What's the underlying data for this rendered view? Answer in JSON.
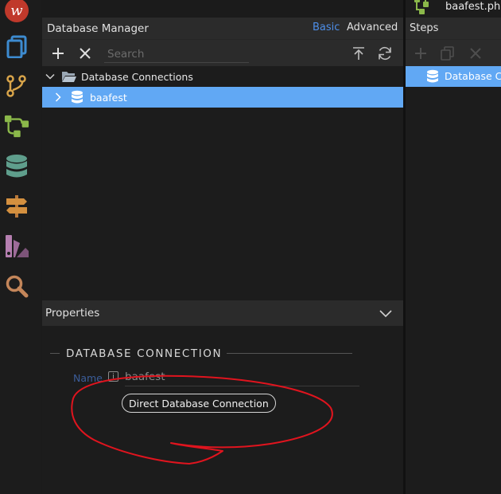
{
  "db_manager": {
    "title": "Database Manager",
    "mode_basic": "Basic",
    "mode_advanced": "Advanced",
    "search_placeholder": "Search",
    "tree": {
      "root_label": "Database Connections",
      "child_label": "baafest"
    }
  },
  "properties": {
    "title": "Properties",
    "section_title": "DATABASE CONNECTION",
    "name_label": "Name",
    "info_glyph": "i",
    "name_value": "baafest",
    "connection_type": "Direct Database Connection"
  },
  "right_panel": {
    "file_tab": "baafest.php",
    "steps_title": "Steps",
    "selected_step": "Database Connection"
  },
  "colors": {
    "accent_blue": "#4d8ee8",
    "selection": "#61a8f4",
    "annotation_red": "#e0141e"
  }
}
